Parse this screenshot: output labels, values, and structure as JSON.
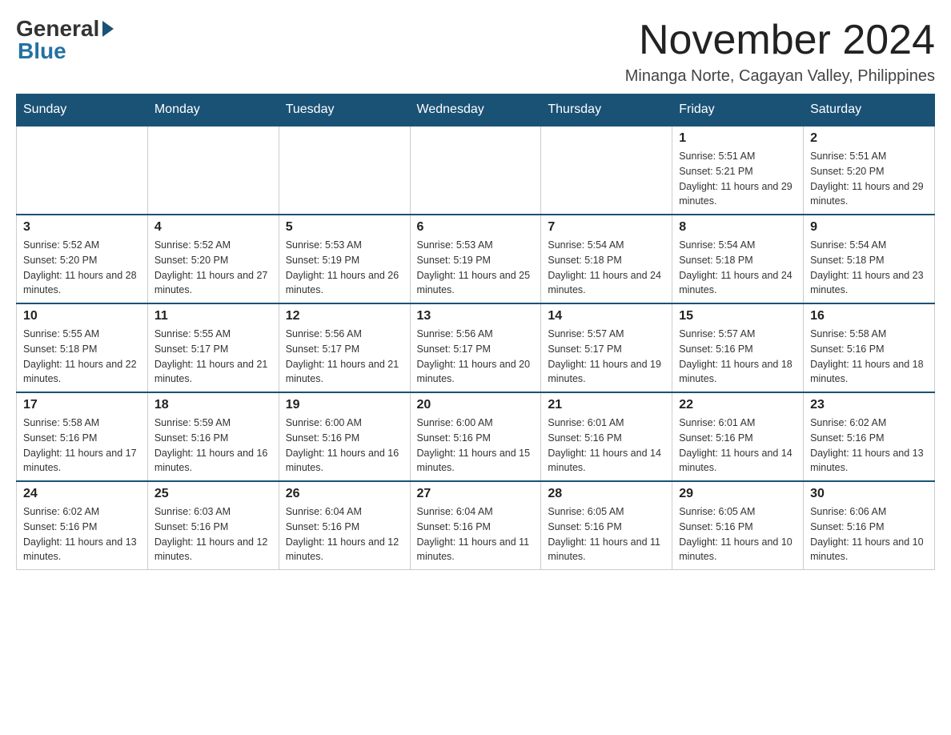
{
  "header": {
    "logo_text1": "General",
    "logo_text2": "Blue",
    "month_title": "November 2024",
    "subtitle": "Minanga Norte, Cagayan Valley, Philippines"
  },
  "days_of_week": [
    "Sunday",
    "Monday",
    "Tuesday",
    "Wednesday",
    "Thursday",
    "Friday",
    "Saturday"
  ],
  "weeks": [
    [
      {
        "day": null,
        "info": null
      },
      {
        "day": null,
        "info": null
      },
      {
        "day": null,
        "info": null
      },
      {
        "day": null,
        "info": null
      },
      {
        "day": null,
        "info": null
      },
      {
        "day": "1",
        "info": "Sunrise: 5:51 AM\nSunset: 5:21 PM\nDaylight: 11 hours and 29 minutes."
      },
      {
        "day": "2",
        "info": "Sunrise: 5:51 AM\nSunset: 5:20 PM\nDaylight: 11 hours and 29 minutes."
      }
    ],
    [
      {
        "day": "3",
        "info": "Sunrise: 5:52 AM\nSunset: 5:20 PM\nDaylight: 11 hours and 28 minutes."
      },
      {
        "day": "4",
        "info": "Sunrise: 5:52 AM\nSunset: 5:20 PM\nDaylight: 11 hours and 27 minutes."
      },
      {
        "day": "5",
        "info": "Sunrise: 5:53 AM\nSunset: 5:19 PM\nDaylight: 11 hours and 26 minutes."
      },
      {
        "day": "6",
        "info": "Sunrise: 5:53 AM\nSunset: 5:19 PM\nDaylight: 11 hours and 25 minutes."
      },
      {
        "day": "7",
        "info": "Sunrise: 5:54 AM\nSunset: 5:18 PM\nDaylight: 11 hours and 24 minutes."
      },
      {
        "day": "8",
        "info": "Sunrise: 5:54 AM\nSunset: 5:18 PM\nDaylight: 11 hours and 24 minutes."
      },
      {
        "day": "9",
        "info": "Sunrise: 5:54 AM\nSunset: 5:18 PM\nDaylight: 11 hours and 23 minutes."
      }
    ],
    [
      {
        "day": "10",
        "info": "Sunrise: 5:55 AM\nSunset: 5:18 PM\nDaylight: 11 hours and 22 minutes."
      },
      {
        "day": "11",
        "info": "Sunrise: 5:55 AM\nSunset: 5:17 PM\nDaylight: 11 hours and 21 minutes."
      },
      {
        "day": "12",
        "info": "Sunrise: 5:56 AM\nSunset: 5:17 PM\nDaylight: 11 hours and 21 minutes."
      },
      {
        "day": "13",
        "info": "Sunrise: 5:56 AM\nSunset: 5:17 PM\nDaylight: 11 hours and 20 minutes."
      },
      {
        "day": "14",
        "info": "Sunrise: 5:57 AM\nSunset: 5:17 PM\nDaylight: 11 hours and 19 minutes."
      },
      {
        "day": "15",
        "info": "Sunrise: 5:57 AM\nSunset: 5:16 PM\nDaylight: 11 hours and 18 minutes."
      },
      {
        "day": "16",
        "info": "Sunrise: 5:58 AM\nSunset: 5:16 PM\nDaylight: 11 hours and 18 minutes."
      }
    ],
    [
      {
        "day": "17",
        "info": "Sunrise: 5:58 AM\nSunset: 5:16 PM\nDaylight: 11 hours and 17 minutes."
      },
      {
        "day": "18",
        "info": "Sunrise: 5:59 AM\nSunset: 5:16 PM\nDaylight: 11 hours and 16 minutes."
      },
      {
        "day": "19",
        "info": "Sunrise: 6:00 AM\nSunset: 5:16 PM\nDaylight: 11 hours and 16 minutes."
      },
      {
        "day": "20",
        "info": "Sunrise: 6:00 AM\nSunset: 5:16 PM\nDaylight: 11 hours and 15 minutes."
      },
      {
        "day": "21",
        "info": "Sunrise: 6:01 AM\nSunset: 5:16 PM\nDaylight: 11 hours and 14 minutes."
      },
      {
        "day": "22",
        "info": "Sunrise: 6:01 AM\nSunset: 5:16 PM\nDaylight: 11 hours and 14 minutes."
      },
      {
        "day": "23",
        "info": "Sunrise: 6:02 AM\nSunset: 5:16 PM\nDaylight: 11 hours and 13 minutes."
      }
    ],
    [
      {
        "day": "24",
        "info": "Sunrise: 6:02 AM\nSunset: 5:16 PM\nDaylight: 11 hours and 13 minutes."
      },
      {
        "day": "25",
        "info": "Sunrise: 6:03 AM\nSunset: 5:16 PM\nDaylight: 11 hours and 12 minutes."
      },
      {
        "day": "26",
        "info": "Sunrise: 6:04 AM\nSunset: 5:16 PM\nDaylight: 11 hours and 12 minutes."
      },
      {
        "day": "27",
        "info": "Sunrise: 6:04 AM\nSunset: 5:16 PM\nDaylight: 11 hours and 11 minutes."
      },
      {
        "day": "28",
        "info": "Sunrise: 6:05 AM\nSunset: 5:16 PM\nDaylight: 11 hours and 11 minutes."
      },
      {
        "day": "29",
        "info": "Sunrise: 6:05 AM\nSunset: 5:16 PM\nDaylight: 11 hours and 10 minutes."
      },
      {
        "day": "30",
        "info": "Sunrise: 6:06 AM\nSunset: 5:16 PM\nDaylight: 11 hours and 10 minutes."
      }
    ]
  ]
}
